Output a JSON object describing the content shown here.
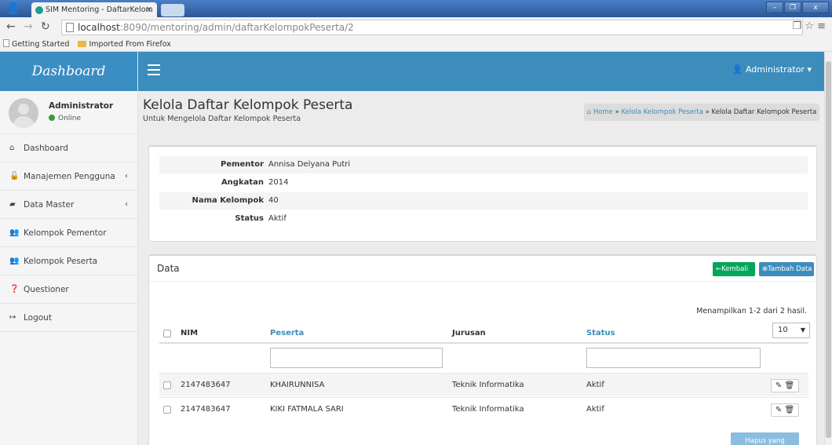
{
  "browser": {
    "tab_title": "SIM Mentoring - DaftarKelom",
    "tab_close": "×",
    "url_host": "localhost",
    "url_path": ":8090/mentoring/admin/daftarKelompokPeserta/2",
    "bookmarks": [
      "Getting Started",
      "Imported From Firefox"
    ],
    "window_buttons": [
      "–",
      "❐",
      "x"
    ]
  },
  "sidebar": {
    "brand": "Dashboard",
    "user_name": "Administrator",
    "user_status": "Online",
    "items": [
      {
        "label": "Dashboard",
        "icon": "home-icon",
        "glyph": "⌂"
      },
      {
        "label": "Manajemen Pengguna",
        "icon": "unlock-icon",
        "glyph": "🔓",
        "caret": "‹"
      },
      {
        "label": "Data Master",
        "icon": "book-icon",
        "glyph": "▰",
        "caret": "‹"
      },
      {
        "label": "Kelompok Pementor",
        "icon": "group-icon",
        "glyph": "👥"
      },
      {
        "label": "Kelompok Peserta",
        "icon": "group-icon",
        "glyph": "👥"
      },
      {
        "label": "Questioner",
        "icon": "question-circle-icon",
        "glyph": "❓"
      },
      {
        "label": "Logout",
        "icon": "sign-out-icon",
        "glyph": "↦"
      }
    ]
  },
  "topbar": {
    "user_menu": "Administrator"
  },
  "header": {
    "title": "Kelola Daftar Kelompok Peserta",
    "subtitle": "Untuk Mengelola Daftar Kelompok Peserta",
    "breadcrumb": {
      "home": "Home",
      "sep": "»",
      "level1": "Kelola Kelompok Peserta",
      "current": "Kelola Daftar Kelompok Peserta"
    }
  },
  "info": [
    {
      "label": "Pementor",
      "value": "Annisa Delyana Putri"
    },
    {
      "label": "Angkatan",
      "value": "2014"
    },
    {
      "label": "Nama Kelompok",
      "value": "40"
    },
    {
      "label": "Status",
      "value": "Aktif"
    }
  ],
  "data_box": {
    "title": "Data",
    "back_button": "Kembali",
    "add_button": "Tambah Data",
    "summary": "Menampilkan 1-2 dari 2 hasil.",
    "page_size": "10",
    "columns": [
      "NIM",
      "Peserta",
      "Jurusan",
      "Status"
    ],
    "rows": [
      {
        "nim": "2147483647",
        "peserta": "KHAIRUNNISA",
        "jurusan": "Teknik Informatika",
        "status": "Aktif"
      },
      {
        "nim": "2147483647",
        "peserta": "KIKI FATMALA SARI",
        "jurusan": "Teknik Informatika",
        "status": "Aktif"
      }
    ],
    "delete_marked_button": "Hapus yang ditandai"
  },
  "colors": {
    "brand_blue": "#3c8dbc",
    "success_green": "#00a65a",
    "online_green": "#3c9a3c"
  }
}
